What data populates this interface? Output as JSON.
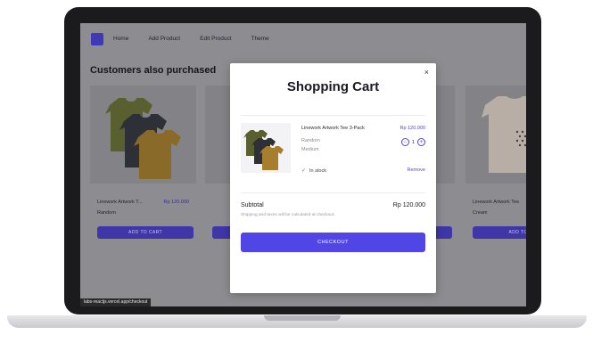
{
  "nav": {
    "links": [
      "Home",
      "Add Product",
      "Edit Product",
      "Theme"
    ]
  },
  "section_title": "Customers also purchased",
  "cards": [
    {
      "name": "Linework Artwork T...",
      "price": "Rp 120.000",
      "variant": "Random",
      "button": "ADD TO CART"
    },
    {
      "name": "",
      "price": "",
      "variant": "",
      "button": ""
    },
    {
      "name": "",
      "price": "",
      "variant": "",
      "button": ""
    },
    {
      "name": "Linework Artwork Tee",
      "price": "",
      "variant": "Cream",
      "button": "ADD TO C"
    }
  ],
  "modal": {
    "close": "×",
    "title": "Shopping Cart",
    "item": {
      "name": "Linework Artwork Tee 3-Pack",
      "price": "Rp 120.000",
      "color": "Random",
      "size": "Medium",
      "quantity": "1",
      "stock": "In stock",
      "remove": "Remove"
    },
    "subtotal_label": "Subtotal",
    "subtotal_value": "Rp 120.000",
    "shipping_note": "Shipping and taxes will be calculated at checkout.",
    "checkout": "CHECKOUT"
  },
  "status_url": "labs-reactjs.vercel.app/checkout",
  "colors": {
    "accent": "#4f46e5",
    "overlay": "#8d8d91",
    "laptop": "#1b1b1d"
  }
}
